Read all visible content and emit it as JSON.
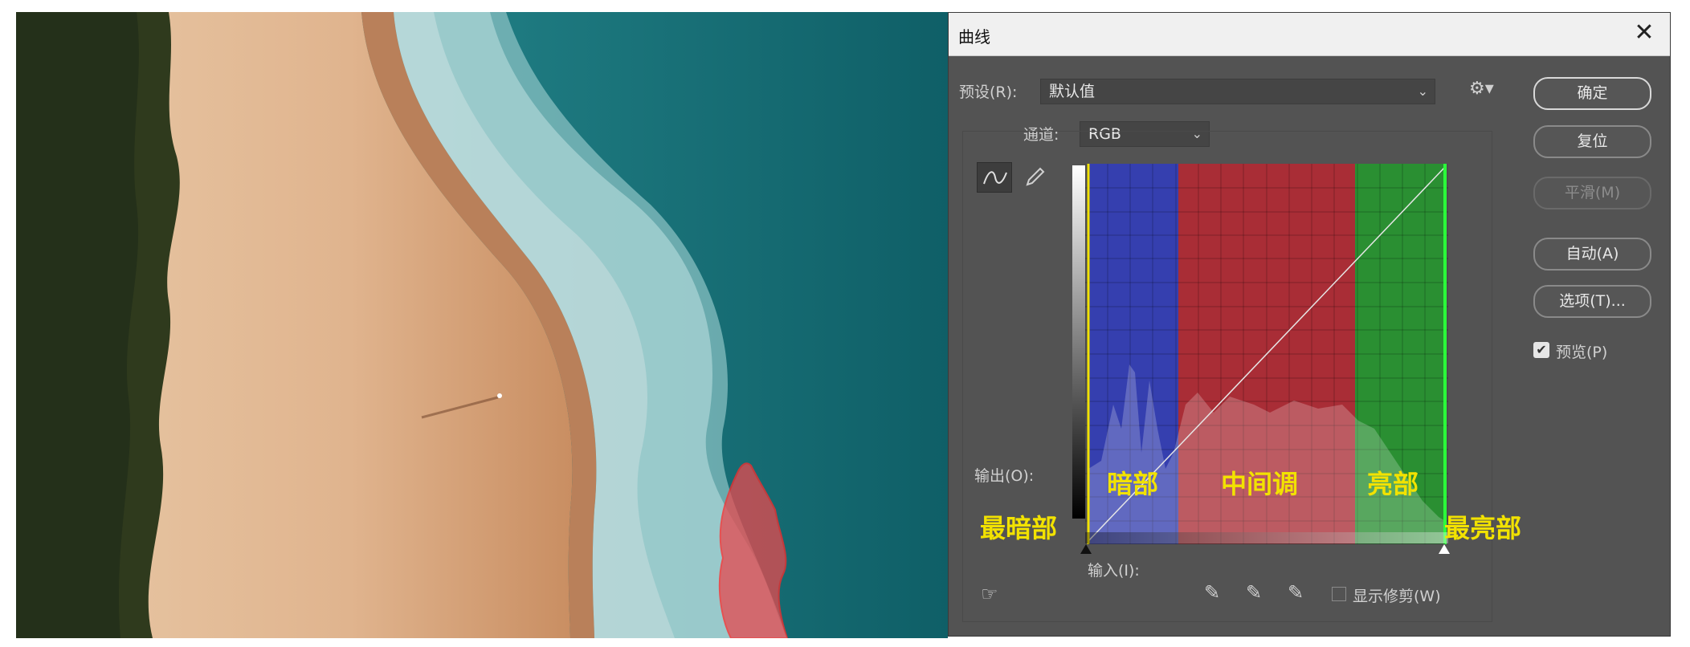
{
  "dialog": {
    "title": "曲线",
    "close_label": "✕",
    "preset_label": "预设(R):",
    "preset_value": "默认值",
    "channel_label": "通道:",
    "channel_value": "RGB",
    "output_label": "输出(O):",
    "input_label": "输入(I):",
    "show_clipping_label": "显示修剪(W)",
    "buttons": {
      "ok": "确定",
      "reset": "复位",
      "smooth": "平滑(M)",
      "auto": "自动(A)",
      "options": "选项(T)..."
    },
    "preview_label": "预览(P)",
    "preview_checked": true
  },
  "annotations": {
    "darkest": "最暗部",
    "shadows": "暗部",
    "midtones": "中间调",
    "highlights": "亮部",
    "brightest": "最亮部"
  },
  "colors": {
    "shadows_overlay": "#2d3bd0",
    "midtones_overlay": "#c8232f",
    "highlights_overlay": "#1fa52a",
    "annotation_text": "#f2e200"
  }
}
